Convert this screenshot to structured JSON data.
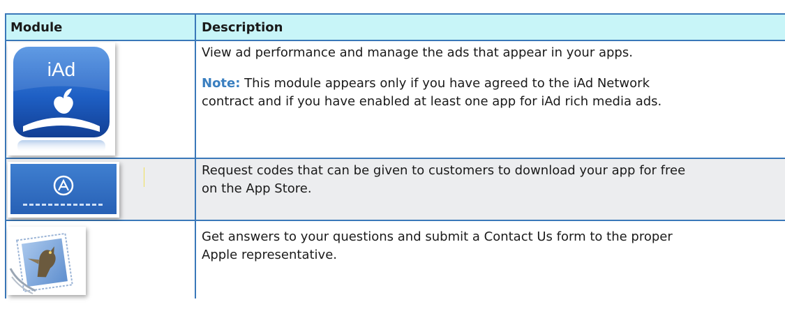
{
  "table": {
    "headers": {
      "module": "Module",
      "description": "Description"
    },
    "rows": [
      {
        "module_icon": "iad-icon",
        "description": "View ad performance and manage the ads that appear in your apps.",
        "note_label": "Note:",
        "note_lines": [
          " This module appears only if you have agreed to the iAd Network",
          "contract and if you have enabled at least one app for iAd rich media ads."
        ],
        "icon_text": "iAd"
      },
      {
        "module_icon": "app-store-promo-codes-icon",
        "description_lines": [
          "Request codes that can be given to customers to download your app for free",
          "on the App Store."
        ]
      },
      {
        "module_icon": "mail-contact-icon",
        "description_lines": [
          "Get answers to your questions and submit a Contact Us form to the proper",
          "Apple representative."
        ]
      }
    ]
  },
  "colors": {
    "border": "#3a78b9",
    "header_bg": "#c8f5f8",
    "alt_row_bg": "#ecedef",
    "note_label": "#3a7fc0"
  }
}
